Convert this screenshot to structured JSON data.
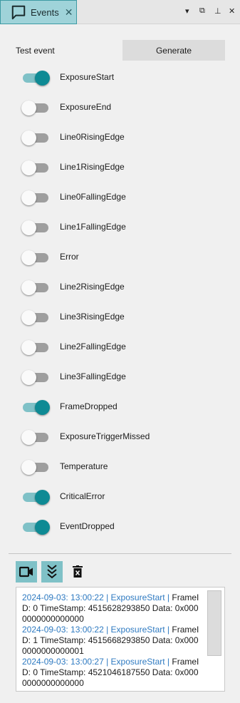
{
  "tab": {
    "title": "Events",
    "icon": "chat-icon",
    "close": "✕"
  },
  "window_controls": {
    "menu": "▾",
    "restore": "⧉",
    "pin": "⊥",
    "close": "✕"
  },
  "test_event": {
    "label": "Test event",
    "generate_label": "Generate"
  },
  "events": [
    {
      "label": "ExposureStart",
      "on": true
    },
    {
      "label": "ExposureEnd",
      "on": false
    },
    {
      "label": "Line0RisingEdge",
      "on": false
    },
    {
      "label": "Line1RisingEdge",
      "on": false
    },
    {
      "label": "Line0FallingEdge",
      "on": false
    },
    {
      "label": "Line1FallingEdge",
      "on": false
    },
    {
      "label": "Error",
      "on": false
    },
    {
      "label": "Line2RisingEdge",
      "on": false
    },
    {
      "label": "Line3RisingEdge",
      "on": false
    },
    {
      "label": "Line2FallingEdge",
      "on": false
    },
    {
      "label": "Line3FallingEdge",
      "on": false
    },
    {
      "label": "FrameDropped",
      "on": true
    },
    {
      "label": "ExposureTriggerMissed",
      "on": false
    },
    {
      "label": "Temperature",
      "on": false
    },
    {
      "label": "CriticalError",
      "on": true
    },
    {
      "label": "EventDropped",
      "on": true
    }
  ],
  "toolbar": [
    {
      "name": "record-button",
      "icon": "video-camera-icon",
      "active": true
    },
    {
      "name": "autoscroll-button",
      "icon": "double-chevron-down-icon",
      "active": true
    },
    {
      "name": "clear-log-button",
      "icon": "trash-icon",
      "active": false
    }
  ],
  "log": [
    {
      "meta": "2024-09-03: 13:00:22 | ExposureStart |",
      "text": " FrameID: 0 TimeStamp: 4515628293850 Data: 0x0000000000000000"
    },
    {
      "meta": "2024-09-03: 13:00:22 | ExposureStart |",
      "text": " FrameID: 1 TimeStamp: 4515668293850 Data: 0x0000000000000001"
    },
    {
      "meta": "2024-09-03: 13:00:27 | ExposureStart |",
      "text": " FrameID: 0 TimeStamp: 4521046187550 Data: 0x0000000000000000"
    }
  ],
  "colors": {
    "accent": "#0e8a94",
    "accent_light": "#7fc1c7",
    "tab_bg": "#9fd3d9",
    "log_meta": "#2e7ac1",
    "panel_bg": "#f0f0f0"
  }
}
